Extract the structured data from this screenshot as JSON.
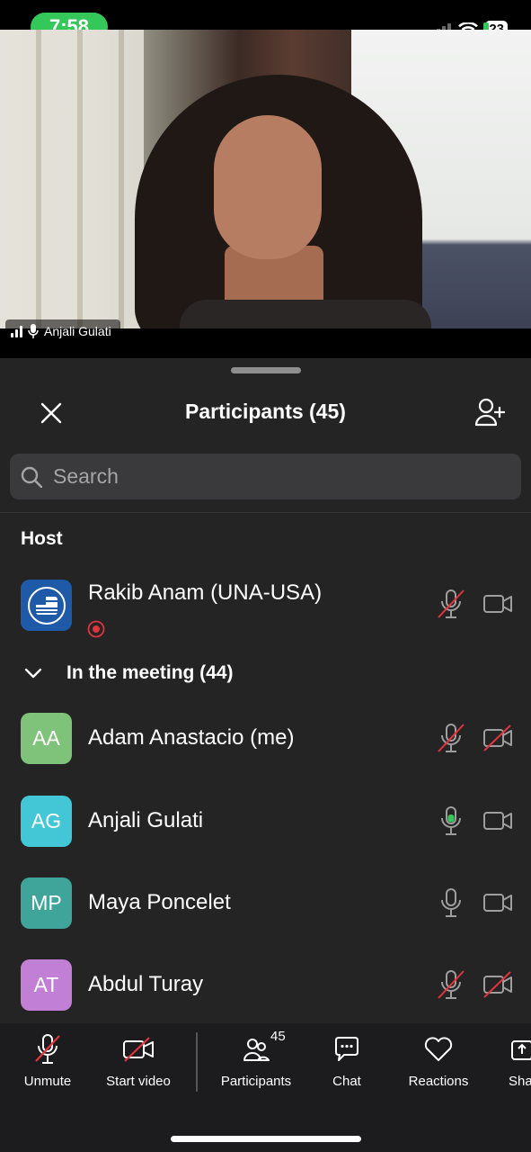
{
  "status": {
    "time": "7:58",
    "battery": "23"
  },
  "video": {
    "speaker_name": "Anjali Gulati"
  },
  "sheet": {
    "title": "Participants (45)",
    "search_placeholder": "Search",
    "host_label": "Host",
    "host": {
      "name": "Rakib Anam (UNA-USA)"
    },
    "group_label": "In the meeting (44)",
    "participants": [
      {
        "initials": "AA",
        "name": "Adam Anastacio (me)",
        "color": "#7fc27a",
        "mic": "muted",
        "video": "off"
      },
      {
        "initials": "AG",
        "name": "Anjali Gulati",
        "color": "#43c7d6",
        "mic": "on",
        "video": "available"
      },
      {
        "initials": "MP",
        "name": "Maya Poncelet",
        "color": "#3fa59b",
        "mic": "available",
        "video": "available"
      },
      {
        "initials": "AT",
        "name": "Abdul Turay",
        "color": "#c27fd6",
        "mic": "muted",
        "video": "off"
      }
    ]
  },
  "toolbar": {
    "unmute": "Unmute",
    "start_video": "Start video",
    "participants": "Participants",
    "participants_count": "45",
    "chat": "Chat",
    "reactions": "Reactions",
    "share": "Sha"
  },
  "colors": {
    "muted_red": "#e0343f",
    "active_green": "#34c759",
    "sheet_bg": "#242424"
  }
}
